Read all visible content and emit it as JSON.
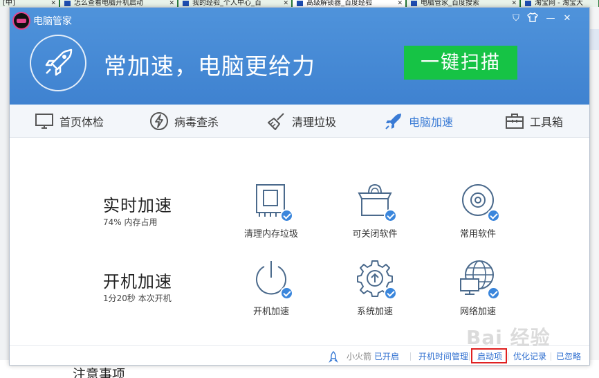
{
  "browser": {
    "tabs": [
      "[中]",
      "怎么查看电脑开机启动",
      "我的经验_个人中心_百",
      "高级解锁器_百度经验",
      "电脑管家_百度搜索",
      "淘宝网 - 淘宝大"
    ],
    "background_heading": "注意事项",
    "side_badge_icon": "sparkle-icon"
  },
  "app": {
    "title": "电脑管家",
    "headline": "常加速，电脑更给力",
    "scan_button": "一键扫描",
    "window_controls": [
      "shield-icon",
      "shirt-icon",
      "minimize-icon",
      "close-icon"
    ],
    "colors": {
      "header_blue": "#4a8cd8",
      "scan_green": "#16c345",
      "active_blue": "#3a7bd5"
    }
  },
  "nav": [
    {
      "label": "首页体检",
      "icon": "monitor-icon"
    },
    {
      "label": "病毒查杀",
      "icon": "lightning-icon"
    },
    {
      "label": "清理垃圾",
      "icon": "broom-icon"
    },
    {
      "label": "电脑加速",
      "icon": "rocket-icon",
      "active": true
    },
    {
      "label": "工具箱",
      "icon": "toolbox-icon"
    }
  ],
  "sections": [
    {
      "title": "实时加速",
      "subtitle": "74% 内存占用"
    },
    {
      "title": "开机加速",
      "subtitle": "1分20秒 本次开机"
    }
  ],
  "features": [
    {
      "label": "清理内存垃圾",
      "icon": "memory-chip-icon"
    },
    {
      "label": "可关闭软件",
      "icon": "software-box-icon"
    },
    {
      "label": "常用软件",
      "icon": "disc-icon"
    },
    {
      "label": "开机加速",
      "icon": "power-icon"
    },
    {
      "label": "系统加速",
      "icon": "gear-icon"
    },
    {
      "label": "网络加速",
      "icon": "network-globe-icon"
    }
  ],
  "footer": {
    "rocket_label": "小火箭",
    "rocket_status": "已开启",
    "links": [
      "开机时间管理",
      "启动项",
      "优化记录",
      "已忽略"
    ]
  },
  "watermark": "Bai 经验"
}
